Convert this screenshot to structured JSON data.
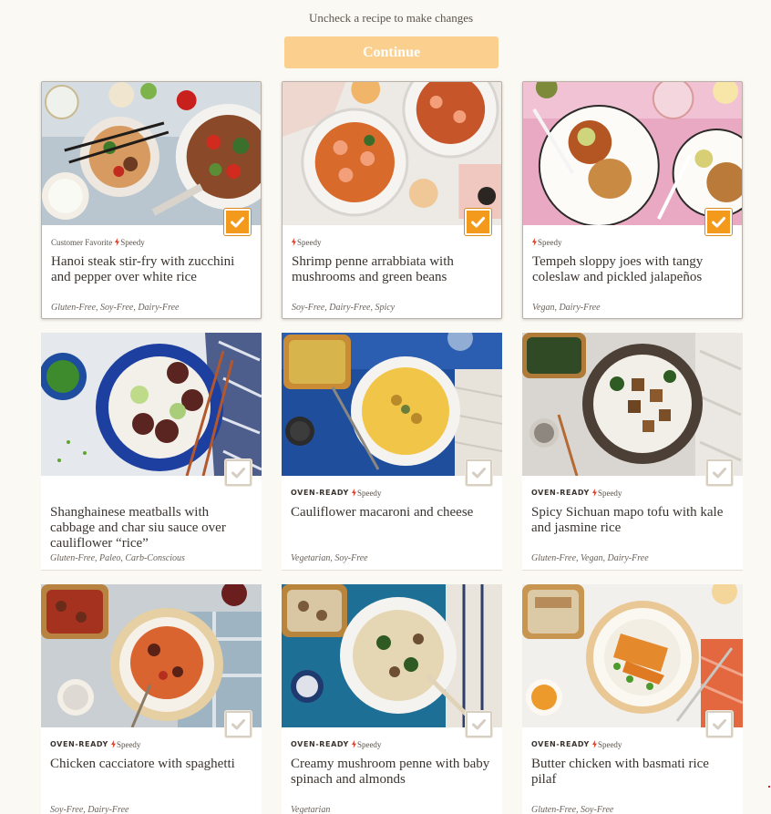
{
  "header": {
    "instruction": "Uncheck a recipe to make changes",
    "continue_label": "Continue"
  },
  "colors": {
    "accent": "#f39a1c",
    "continue_bg": "#fbd08e",
    "page_bg": "#fbf9f4",
    "speedy_red": "#e0402c"
  },
  "recipes": [
    {
      "title": "Hanoi steak stir-fry with zucchini and pepper over white rice",
      "tags": "Gluten-Free, Soy-Free, Dairy-Free",
      "badge_primary": "Customer Favorite",
      "badge_speedy": "Speedy",
      "selected": true
    },
    {
      "title": "Shrimp penne arrabbiata with mushrooms and green beans",
      "tags": "Soy-Free, Dairy-Free, Spicy",
      "badge_primary": "",
      "badge_speedy": "Speedy",
      "selected": true
    },
    {
      "title": "Tempeh sloppy joes with tangy coleslaw and pickled jalapeños",
      "tags": "Vegan, Dairy-Free",
      "badge_primary": "",
      "badge_speedy": "Speedy",
      "selected": true
    },
    {
      "title": "Shanghainese meatballs with cabbage and char siu sauce over cauliflower “rice”",
      "tags": "Gluten-Free, Paleo, Carb-Conscious",
      "badge_primary": "",
      "badge_speedy": "",
      "selected": false
    },
    {
      "title": "Cauliflower macaroni and cheese",
      "tags": "Vegetarian, Soy-Free",
      "badge_primary": "OVEN-READY",
      "badge_speedy": "Speedy",
      "selected": false
    },
    {
      "title": "Spicy Sichuan mapo tofu with kale and jasmine rice",
      "tags": "Gluten-Free, Vegan, Dairy-Free",
      "badge_primary": "OVEN-READY",
      "badge_speedy": "Speedy",
      "selected": false
    },
    {
      "title": "Chicken cacciatore with spaghetti",
      "tags": "Soy-Free, Dairy-Free",
      "badge_primary": "OVEN-READY",
      "badge_speedy": "Speedy",
      "selected": false
    },
    {
      "title": "Creamy mushroom penne with baby spinach and almonds",
      "tags": "Vegetarian",
      "badge_primary": "OVEN-READY",
      "badge_speedy": "Speedy",
      "selected": false
    },
    {
      "title": "Butter chicken with basmati rice pilaf",
      "tags": "Gluten-Free, Soy-Free",
      "badge_primary": "OVEN-READY",
      "badge_speedy": "Speedy",
      "selected": false
    }
  ]
}
